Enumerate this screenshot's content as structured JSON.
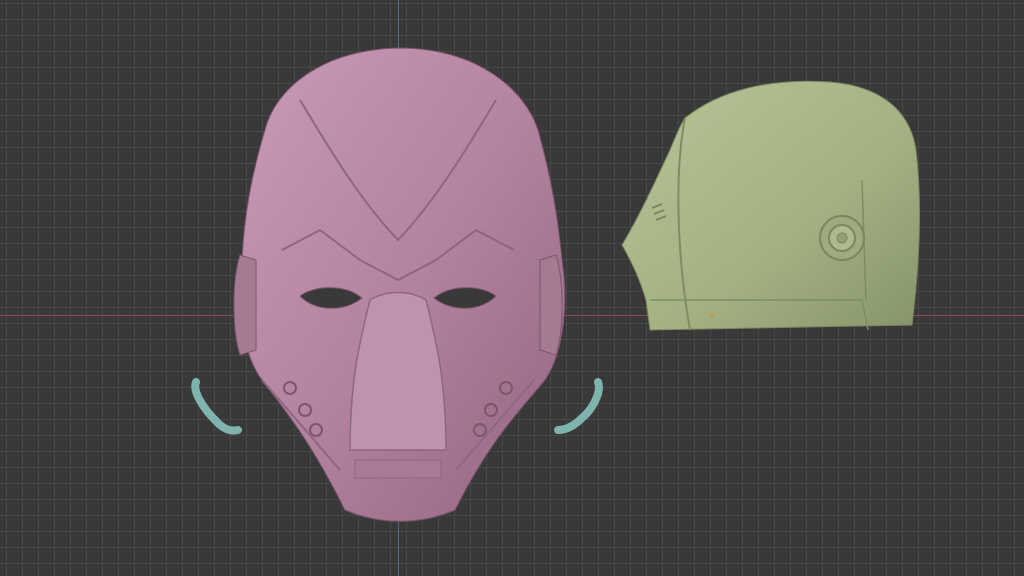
{
  "viewport": {
    "background": "#393939",
    "grid_color": "#464646",
    "x_axis_color": "#8a4b52",
    "y_axis_color": "#4b6b90"
  },
  "objects": [
    {
      "name": "mask-front",
      "color": "#b98aa8"
    },
    {
      "name": "helmet-side",
      "color": "#a6b486"
    },
    {
      "name": "strap-left",
      "color": "#7fb3ae"
    },
    {
      "name": "strap-right",
      "color": "#7fb3ae"
    }
  ]
}
